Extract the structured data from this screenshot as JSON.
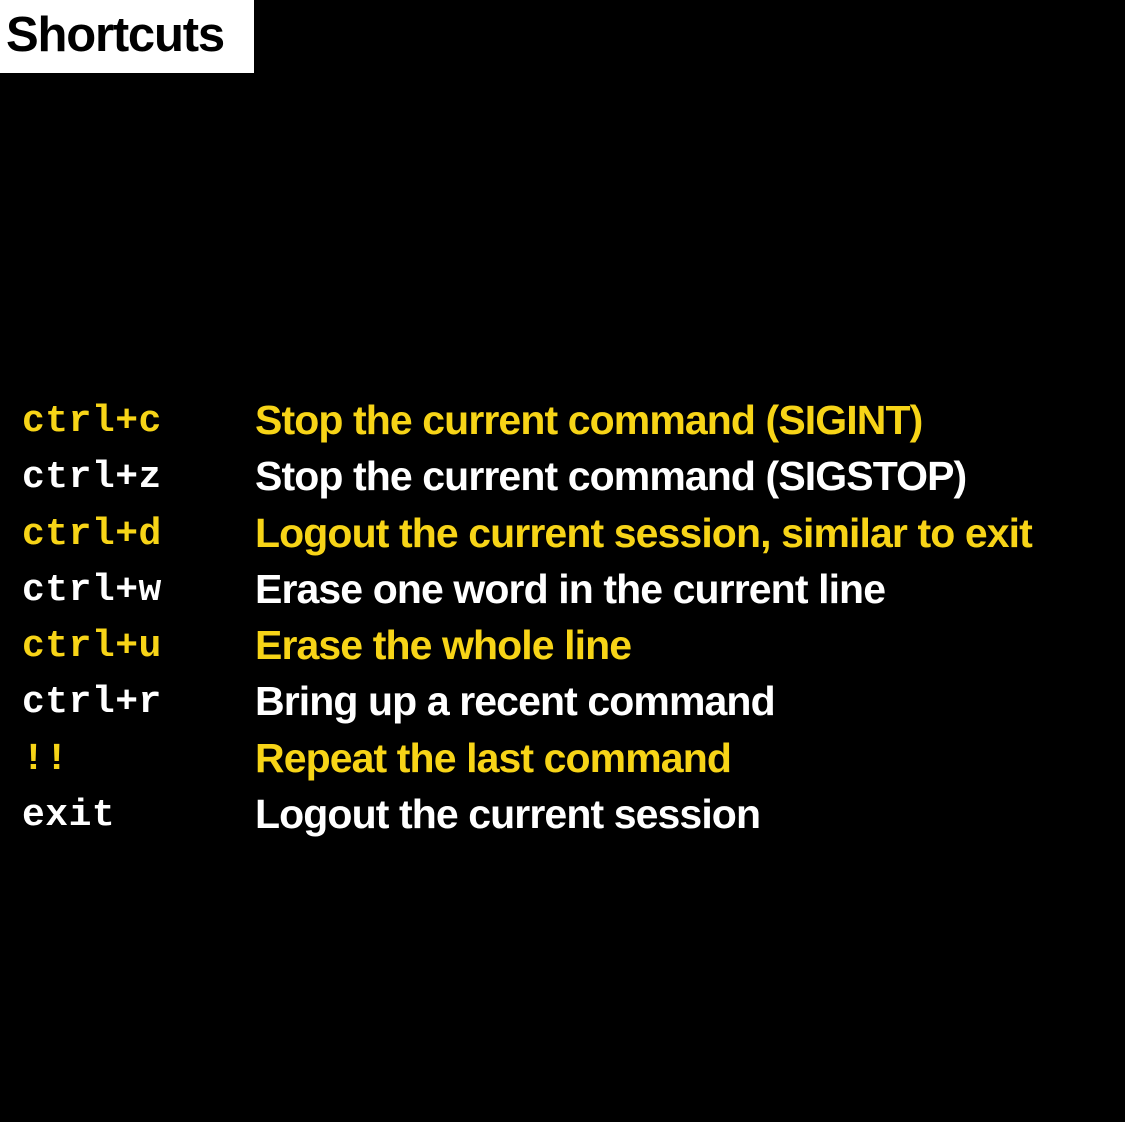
{
  "title": "Shortcuts",
  "colors": {
    "background": "#000000",
    "title_box": "#ffffff",
    "title_text": "#000000",
    "yellow": "#f7d417",
    "white": "#ffffff"
  },
  "shortcuts": [
    {
      "key": "ctrl+c",
      "description": "Stop the current command (SIGINT)",
      "color": "#f7d417"
    },
    {
      "key": "ctrl+z",
      "description": "Stop the current command (SIGSTOP)",
      "color": "#ffffff"
    },
    {
      "key": "ctrl+d",
      "description": "Logout the current session, similar to exit",
      "color": "#f7d417"
    },
    {
      "key": "ctrl+w",
      "description": "Erase one word in the current line",
      "color": "#ffffff"
    },
    {
      "key": "ctrl+u",
      "description": "Erase the whole line",
      "color": "#f7d417"
    },
    {
      "key": "ctrl+r",
      "description": "Bring up a recent command",
      "color": "#ffffff"
    },
    {
      "key": "!!",
      "description": "Repeat the last command",
      "color": "#f7d417"
    },
    {
      "key": "exit",
      "description": "Logout the current session",
      "color": "#ffffff"
    }
  ]
}
